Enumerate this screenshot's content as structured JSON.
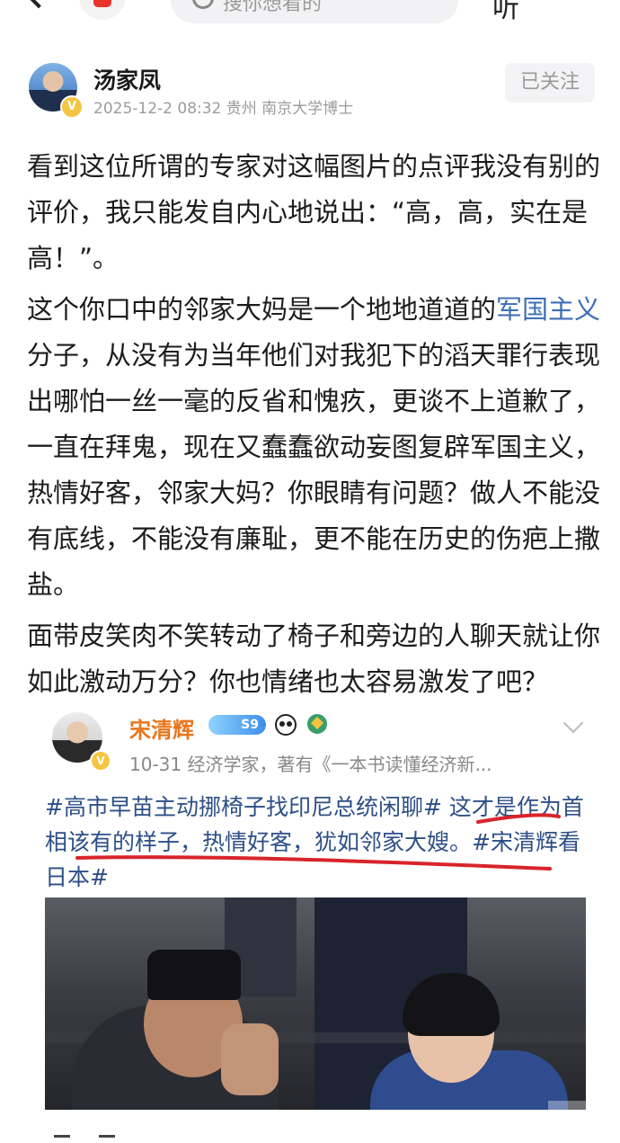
{
  "topbar": {
    "search_placeholder": "搜你想看的",
    "right_text": "听"
  },
  "post": {
    "author": "汤家凤",
    "meta": "2025-12-2 08:32 贵州 南京大学博士",
    "follow_label": "已关注",
    "paragraphs": {
      "p1": "看到这位所谓的专家对这幅图片的点评我没有别的评价，我只能发自内心地说出：“高，高，实在是高！”。",
      "p2_before": "这个你口中的邻家大妈是一个地地道道的",
      "p2_link": "军国主义",
      "p2_after": "分子，从没有为当年他们对我犯下的滔天罪行表现出哪怕一丝一毫的反省和愧疚，更谈不上道歉了，一直在拜鬼，现在又蠢蠢欲动妄图复辟军国主义，热情好客，邻家大妈？你眼睛有问题？做人不能没有底线，不能没有廉耻，更不能在历史的伤疤上撒盐。",
      "p3": "面带皮笑肉不笑转动了椅子和旁边的人聊天就让你如此激动万分？你也情绪也太容易激发了吧？"
    }
  },
  "embed": {
    "author": "宋清辉",
    "level_badge": "S9",
    "meta": "10-31  经济学家，著有《一本书读懂经济新...",
    "text_topic1": "#高市早苗主动挪椅子找印尼总统闲聊#",
    "text_body": " 这才是作为首相该有的样子，热情好客，犹如邻家大嫂。",
    "text_topic2": "#宋清辉看日本#"
  },
  "colors": {
    "link_blue": "#3d6eb5",
    "embed_name_orange": "#e8761c",
    "underline_red": "#d8242b",
    "meta_gray": "#9b9b9b"
  }
}
